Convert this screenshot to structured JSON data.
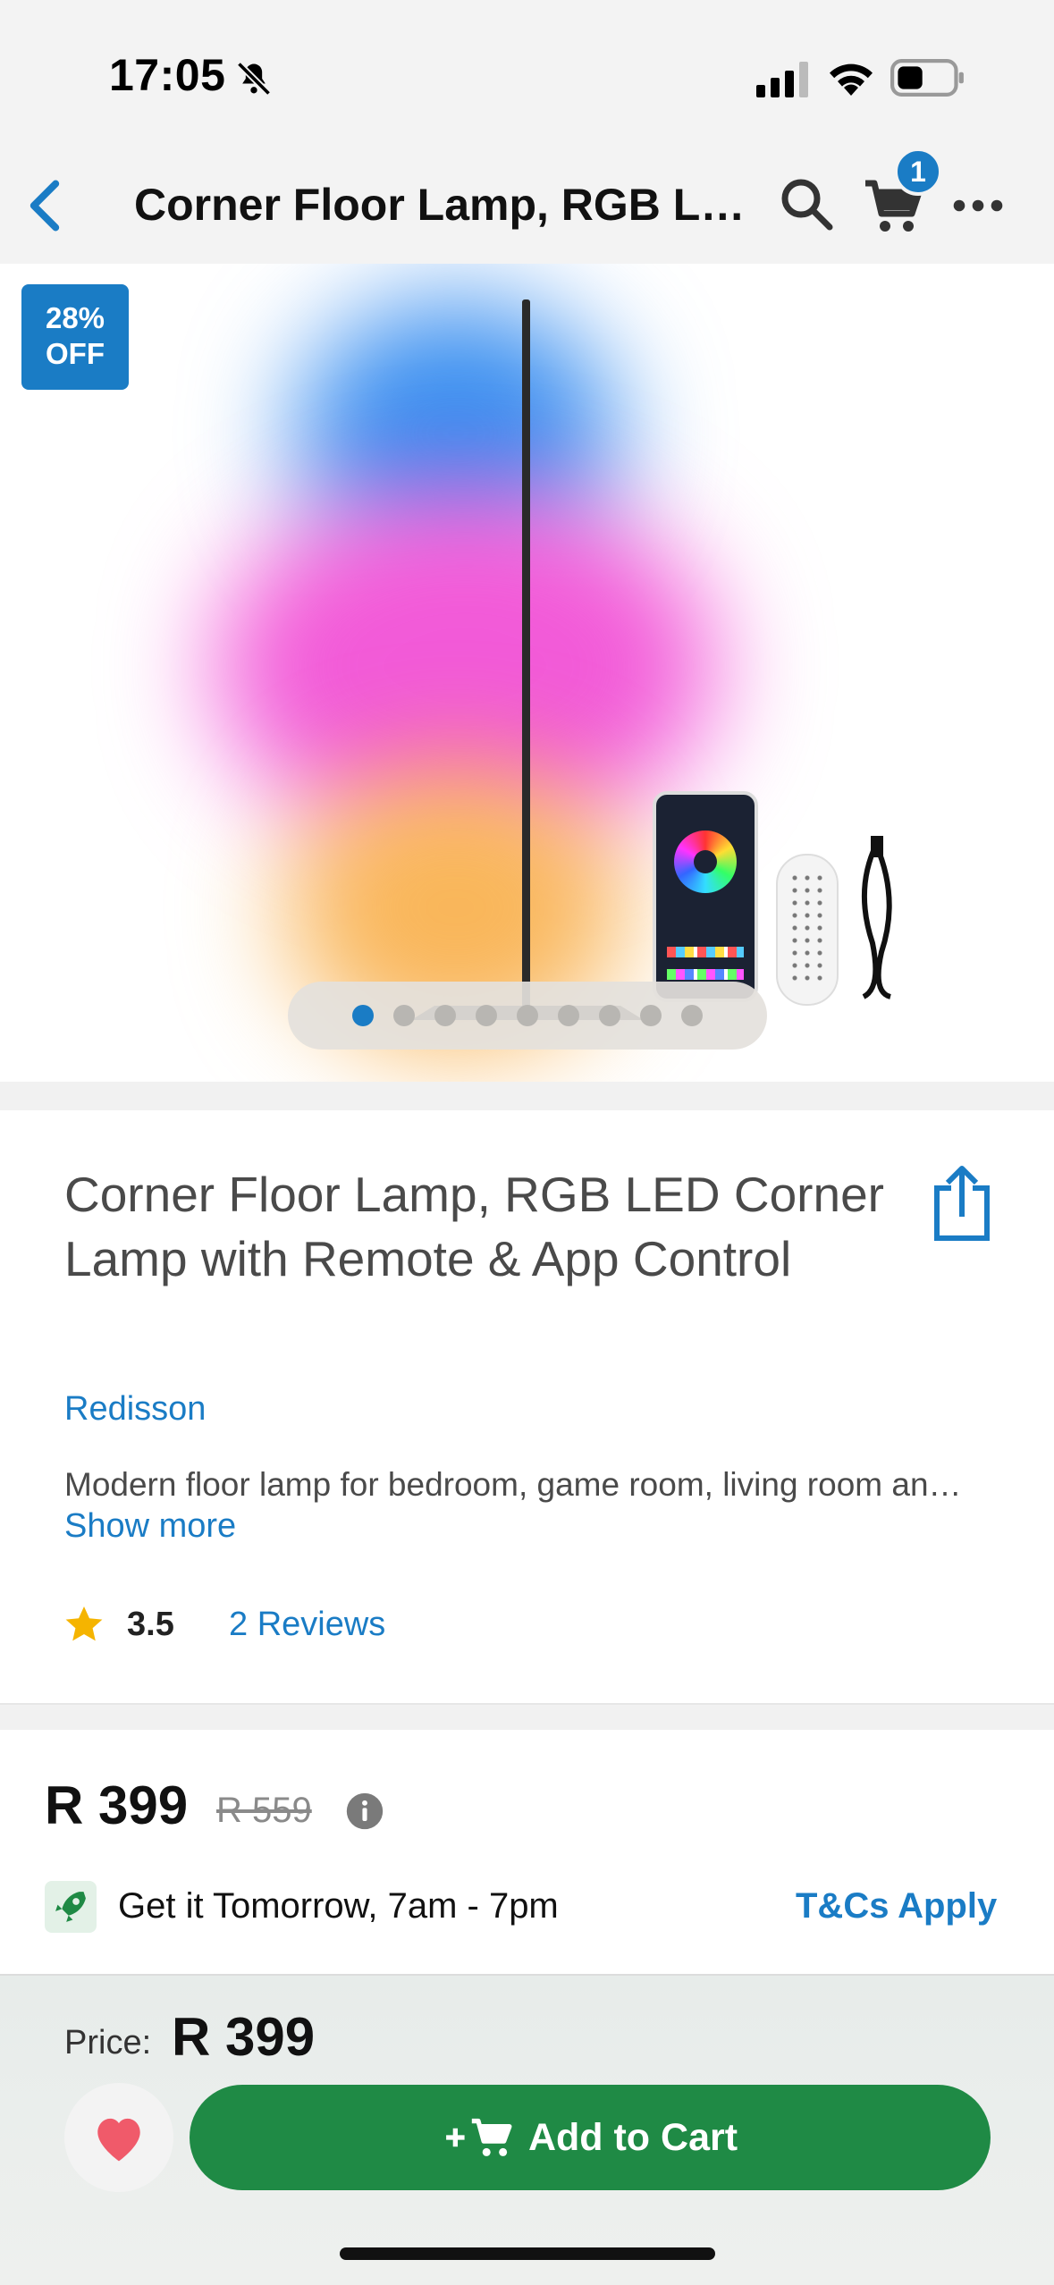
{
  "status_bar": {
    "time": "17:05"
  },
  "nav": {
    "title": "Corner Floor Lamp, RGB LED Corner Lamp with Remote & App Control",
    "cart_count": "1"
  },
  "hero": {
    "discount_line1": "28%",
    "discount_line2": "OFF",
    "carousel": {
      "count": 9,
      "active_index": 0
    }
  },
  "product": {
    "title": "Corner Floor Lamp, RGB LED Corner Lamp with Remote & App Control",
    "brand": "Redisson",
    "description": "Modern floor lamp for bedroom, game room, living room and more",
    "show_more": "Show more",
    "rating": "3.5",
    "reviews": "2 Reviews"
  },
  "pricing": {
    "price": "R 399",
    "old_price": "R 559",
    "delivery": "Get it Tomorrow, 7am - 7pm",
    "tcs": "T&Cs Apply"
  },
  "bottom_bar": {
    "price_label": "Price:",
    "price": "R 399",
    "add_to_cart": "Add to Cart"
  },
  "colors": {
    "accent": "#1a7cc5",
    "cta": "#1f8a45",
    "star": "#f5b400",
    "heart": "#f05a6a"
  }
}
